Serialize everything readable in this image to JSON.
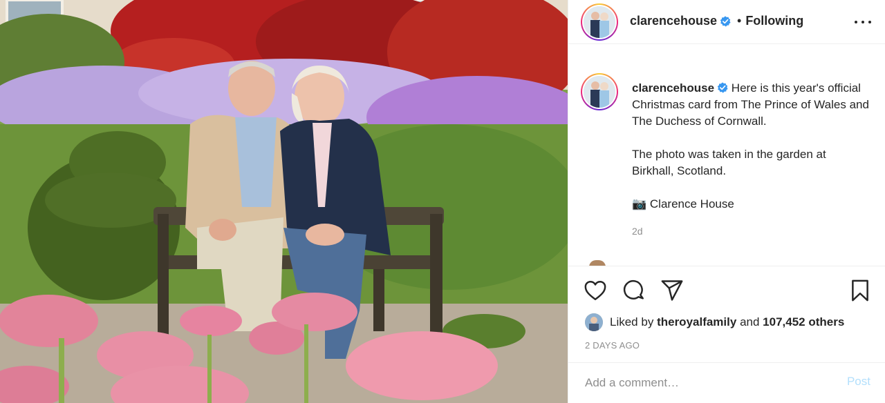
{
  "post": {
    "image_alt": "Christmas card photo",
    "account": {
      "username": "clarencehouse",
      "verified": true,
      "follow_separator": "•",
      "follow_state": "Following"
    },
    "caption": {
      "username": "clarencehouse",
      "line1": "Here is this year's official Christmas card from The Prince of Wales and The Duchess of Cornwall.",
      "line2": "The photo was taken in the garden at Birkhall, Scotland.",
      "line3_icon": "📷",
      "line3": "Clarence House",
      "time": "2d"
    },
    "actions": {
      "icons": [
        "heart-icon",
        "comment-icon",
        "share-icon",
        "bookmark-icon"
      ]
    },
    "likes": {
      "prefix": "Liked by",
      "user": "theroyalfamily",
      "joiner": "and",
      "count": "107,452 others"
    },
    "posted": "2 DAYS AGO",
    "comment": {
      "placeholder": "Add a comment…",
      "post_label": "Post"
    },
    "colors": {
      "verified_blue": "#3897f0",
      "muted_text": "#8e8e8e",
      "post_disabled": "#b2dffc",
      "divider": "#efefef"
    }
  }
}
